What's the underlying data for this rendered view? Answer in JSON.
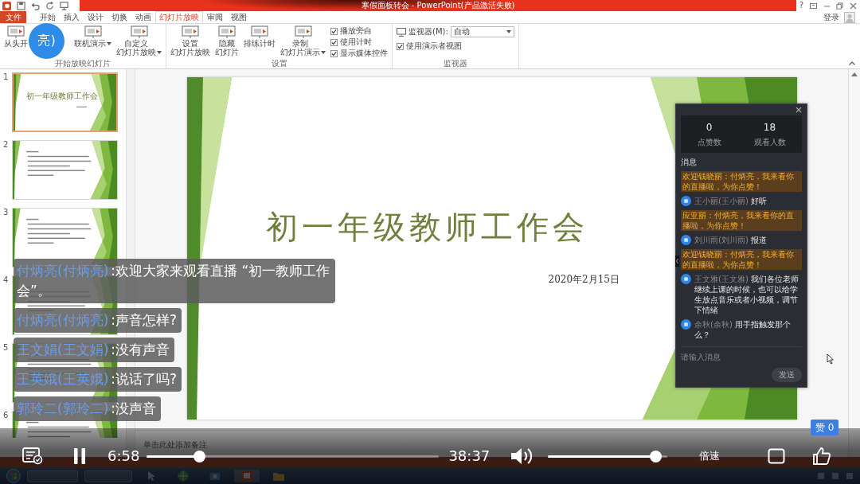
{
  "window": {
    "title": "寒假面板转会 - PowerPoint(产品激活失败)",
    "help": "?",
    "sign_in": "登录"
  },
  "ribbon_tabs": [
    {
      "label": "文件",
      "kind": "file",
      "selected": false
    },
    {
      "label": "开始",
      "kind": "tab",
      "selected": false
    },
    {
      "label": "插入",
      "kind": "tab",
      "selected": false
    },
    {
      "label": "设计",
      "kind": "tab",
      "selected": false
    },
    {
      "label": "切换",
      "kind": "tab",
      "selected": false
    },
    {
      "label": "动画",
      "kind": "tab",
      "selected": false
    },
    {
      "label": "幻灯片放映",
      "kind": "tab",
      "selected": true
    },
    {
      "label": "审阅",
      "kind": "tab",
      "selected": false
    },
    {
      "label": "视图",
      "kind": "tab",
      "selected": false
    }
  ],
  "ribbon_groups": [
    {
      "label": "开始放映幻灯片",
      "buttons": [
        {
          "kind": "button",
          "lines": [
            "从头开"
          ]
        },
        {
          "kind": "menu_button",
          "lines": [
            "联机演示"
          ]
        },
        {
          "kind": "menu_button",
          "lines": [
            "自定义",
            "幻灯片放映"
          ]
        }
      ]
    },
    {
      "label": "设置",
      "buttons": [
        {
          "kind": "button",
          "lines": [
            "设置",
            "幻灯片放映"
          ]
        },
        {
          "kind": "button",
          "lines": [
            "隐藏",
            "幻灯片"
          ]
        },
        {
          "kind": "button",
          "lines": [
            "排练计时"
          ]
        },
        {
          "kind": "menu_button",
          "lines": [
            "录制",
            "幻灯片演示"
          ]
        }
      ],
      "options": [
        {
          "kind": "checkbox",
          "label": "播放旁白",
          "checked": true
        },
        {
          "kind": "checkbox",
          "label": "使用计时",
          "checked": true
        },
        {
          "kind": "checkbox",
          "label": "显示媒体控件",
          "checked": true
        }
      ]
    },
    {
      "label": "监视器",
      "options": [
        {
          "kind": "select",
          "label": "监视器(M):",
          "value": "自动"
        },
        {
          "kind": "checkbox",
          "label": "使用演示者视图",
          "checked": true
        }
      ]
    }
  ],
  "streamer_avatar": {
    "label": "亮)"
  },
  "thumbnails": [
    {
      "number": "1",
      "kind": "title",
      "title": "初一年级教师工作会",
      "selected": true
    },
    {
      "number": "2",
      "kind": "bullets",
      "selected": false
    },
    {
      "number": "3",
      "kind": "bullets",
      "selected": false
    },
    {
      "number": "4",
      "kind": "bullets",
      "selected": false
    },
    {
      "number": "5",
      "kind": "bullets",
      "selected": false
    },
    {
      "number": "6",
      "kind": "bullets",
      "selected": false
    }
  ],
  "slide": {
    "title": "初一年级教师工作会",
    "date": "2020年2月15日"
  },
  "notes": {
    "placeholder": "单击此处添加备注"
  },
  "chat_overlay": [
    {
      "sender": "付炳亮(付炳亮)",
      "text": ":欢迎大家来观看直播 “初一教师工作会”。"
    },
    {
      "sender": "付炳亮(付炳亮)",
      "text": ":声音怎样?"
    },
    {
      "sender": "王文娟(王文娟)",
      "text": ":没有声音"
    },
    {
      "sender": "王英娥(王英娥)",
      "text": ":说话了吗?"
    },
    {
      "sender": "郭玲二(郭玲二)",
      "text": ":没声音"
    }
  ],
  "live_panel": {
    "stats": [
      {
        "value": "0",
        "label": "点赞数"
      },
      {
        "value": "18",
        "label": "观看人数"
      }
    ],
    "heading": "消息",
    "messages": [
      {
        "kind": "system",
        "text": "欢迎钱晓丽：付炳亮，我来看你的直播啦，为你点赞！"
      },
      {
        "kind": "user",
        "sender": "王小丽(王小丽)",
        "text": "好听"
      },
      {
        "kind": "system",
        "text": "应亚丽：付炳亮，我来看你的直播啦，为你点赞！"
      },
      {
        "kind": "user",
        "sender": "刘川雨(刘川雨)",
        "text": "报道"
      },
      {
        "kind": "system",
        "text": "欢迎钱晓丽：付炳亮，我来看你的直播啦，为你点赞！"
      },
      {
        "kind": "user",
        "sender": "王文雅(王文雅)",
        "text": "我们各位老师继续上课的时候，也可以给学生放点音乐或者小视频，调节下情绪"
      },
      {
        "kind": "user",
        "sender": "余秋(余秋)",
        "text": "用手指触发那个么？"
      }
    ],
    "input": {
      "placeholder": "请输入消息"
    },
    "send": "发送"
  },
  "player": {
    "likes": "赞 0",
    "current_time": "6:58",
    "total_time": "38:37",
    "progress": {
      "level": 0.18
    },
    "volume": {
      "level": 0.9
    },
    "speed": "倍速"
  }
}
